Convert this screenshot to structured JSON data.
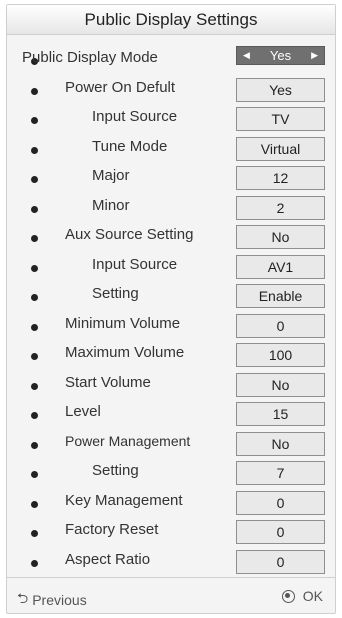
{
  "title": "Public Display Settings",
  "rows": [
    {
      "label": "Public Display Mode",
      "value": "Yes",
      "selected": true
    },
    {
      "label": "Power On Defult",
      "value": "Yes"
    },
    {
      "label": "Input Source",
      "value": "TV"
    },
    {
      "label": "Tune Mode",
      "value": "Virtual"
    },
    {
      "label": "Major",
      "value": "12"
    },
    {
      "label": "Minor",
      "value": "2"
    },
    {
      "label": "Aux Source Setting",
      "value": "No"
    },
    {
      "label": "Input Source",
      "value": "AV1"
    },
    {
      "label": "Setting",
      "value": "Enable"
    },
    {
      "label": "Minimum Volume",
      "value": "0"
    },
    {
      "label": "Maximum Volume",
      "value": "100"
    },
    {
      "label": "Start Volume",
      "value": "No"
    },
    {
      "label": "Level",
      "value": "15"
    },
    {
      "label": "Power Management",
      "value": "No"
    },
    {
      "label": "Setting",
      "value": "7"
    },
    {
      "label": "Key Management",
      "value": "0"
    },
    {
      "label": "Factory Reset",
      "value": "0"
    },
    {
      "label": "Aspect Ratio",
      "value": "0"
    }
  ],
  "footer": {
    "previous_label": "Previous",
    "ok_label": "OK",
    "previous_icon": "return-icon",
    "ok_icon": "ok-button-icon"
  },
  "colors": {
    "selected_bg": "#707070",
    "value_bg": "#e9e9e9",
    "panel_bg": "#f4f4f4"
  }
}
